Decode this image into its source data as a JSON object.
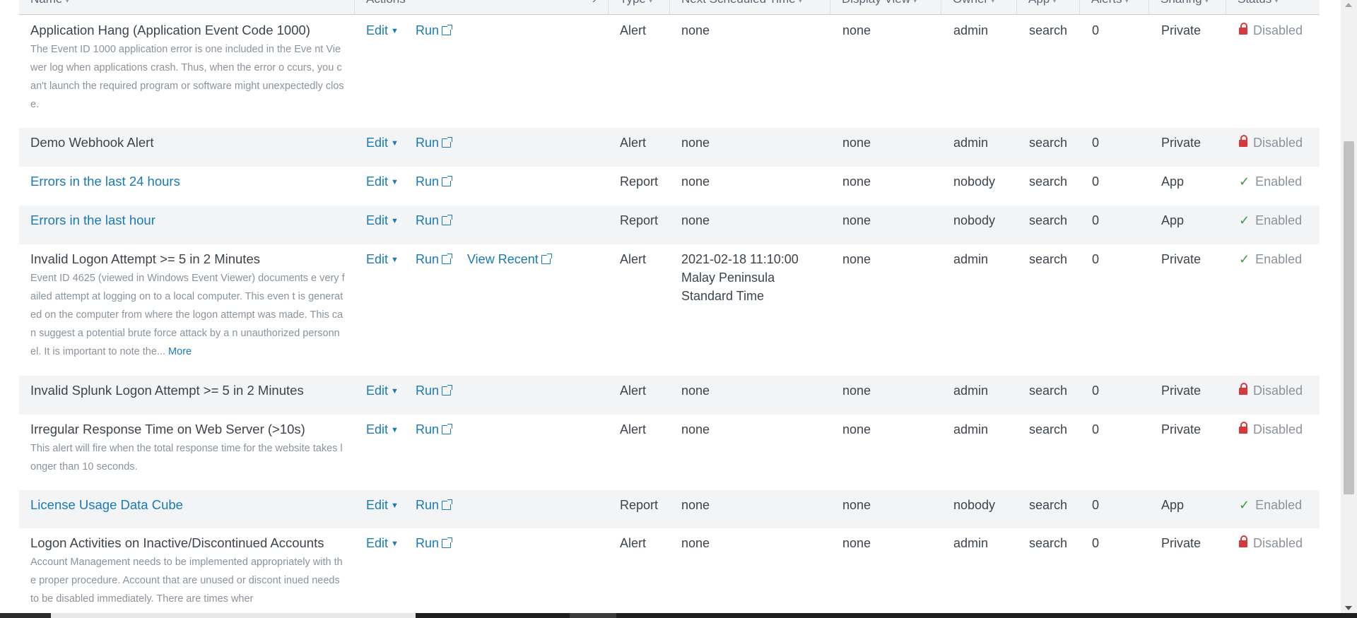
{
  "columns": {
    "name": "Name",
    "actions": "Actions",
    "type": "Type",
    "next_scheduled": "Next Scheduled Time",
    "display_view": "Display View",
    "owner": "Owner",
    "app": "App",
    "alerts": "Alerts",
    "sharing": "Sharing",
    "status": "Status"
  },
  "labels": {
    "edit": "Edit",
    "run": "Run",
    "view_recent": "View Recent",
    "more": "More"
  },
  "rows": [
    {
      "name": "Application Hang (Application Event Code 1000)",
      "description": "The Event ID 1000 application error is one included in the Eve nt Viewer log when applications crash. Thus, when the error o ccurs, you can't launch the required program or software might unexpectedly close.",
      "type": "Alert",
      "next": "none",
      "display_view": "none",
      "owner": "admin",
      "app": "search",
      "alerts": "0",
      "sharing": "Private",
      "status": "Disabled"
    },
    {
      "name": "Demo Webhook Alert",
      "type": "Alert",
      "next": "none",
      "display_view": "none",
      "owner": "admin",
      "app": "search",
      "alerts": "0",
      "sharing": "Private",
      "status": "Disabled"
    },
    {
      "name": "Errors in the last 24 hours",
      "type": "Report",
      "next": "none",
      "display_view": "none",
      "owner": "nobody",
      "app": "search",
      "alerts": "0",
      "sharing": "App",
      "status": "Enabled"
    },
    {
      "name": "Errors in the last hour",
      "type": "Report",
      "next": "none",
      "display_view": "none",
      "owner": "nobody",
      "app": "search",
      "alerts": "0",
      "sharing": "App",
      "status": "Enabled"
    },
    {
      "name": "Invalid Logon Attempt >= 5 in 2 Minutes",
      "description": "Event ID 4625 (viewed in Windows Event Viewer) documents e very failed attempt at logging on to a local computer. This even t is generated on the computer from where the logon attempt was made. This can suggest a potential brute force attack by a n unauthorized personnel. It is important to note the...",
      "type": "Alert",
      "next_line1": "2021-02-18 11:10:00",
      "next_line2": "Malay Peninsula",
      "next_line3": "Standard Time",
      "display_view": "none",
      "owner": "admin",
      "app": "search",
      "alerts": "0",
      "sharing": "Private",
      "status": "Enabled"
    },
    {
      "name": "Invalid Splunk Logon Attempt >= 5 in 2 Minutes",
      "type": "Alert",
      "next": "none",
      "display_view": "none",
      "owner": "admin",
      "app": "search",
      "alerts": "0",
      "sharing": "Private",
      "status": "Disabled"
    },
    {
      "name": "Irregular Response Time on Web Server (>10s)",
      "description": "This alert will fire when the total response time for the website takes longer than 10 seconds.",
      "type": "Alert",
      "next": "none",
      "display_view": "none",
      "owner": "admin",
      "app": "search",
      "alerts": "0",
      "sharing": "Private",
      "status": "Disabled"
    },
    {
      "name": "License Usage Data Cube",
      "type": "Report",
      "next": "none",
      "display_view": "none",
      "owner": "nobody",
      "app": "search",
      "alerts": "0",
      "sharing": "App",
      "status": "Enabled"
    },
    {
      "name": "Logon Activities on Inactive/Discontinued Accounts",
      "description": "Account Management needs to be implemented appropriately with the proper procedure. Account that are unused or discont inued needs to be disabled immediately. There are times wher",
      "type": "Alert",
      "next": "none",
      "display_view": "none",
      "owner": "admin",
      "app": "search",
      "alerts": "0",
      "sharing": "Private",
      "status": "Disabled"
    }
  ]
}
